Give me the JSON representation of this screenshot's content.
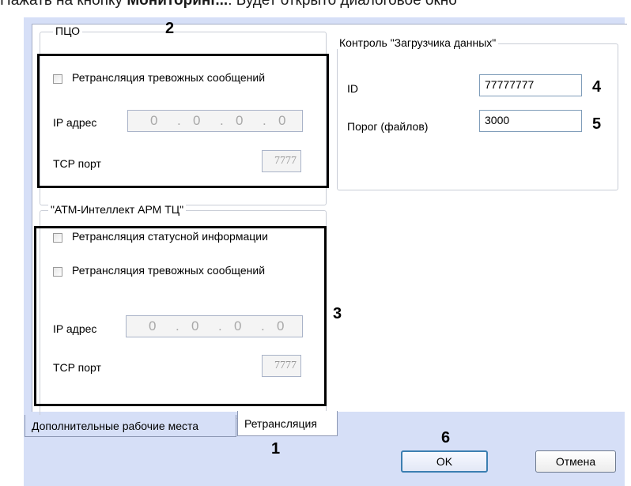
{
  "caption": {
    "prefix": "Нажать на кнопку ",
    "bold": "Мониторинг...",
    "suffix": ". Будет открыто диалоговое окно"
  },
  "pco": {
    "legend": "ПЦО",
    "relay_alarm_label": "Ретрансляция тревожных сообщений",
    "ip_label": "IP адрес",
    "ip_octets": [
      "0",
      "0",
      "0",
      "0"
    ],
    "tcp_label": "TCP порт",
    "tcp_port": "7777"
  },
  "atm": {
    "legend": "\"АТМ-Интеллект АРМ ТЦ\"",
    "relay_status_label": "Ретрансляция статусной информации",
    "relay_alarm_label": "Ретрансляция тревожных сообщений",
    "ip_label": "IP адрес",
    "ip_octets": [
      "0",
      "0",
      "0",
      "0"
    ],
    "tcp_label": "TCP порт",
    "tcp_port": "7777"
  },
  "loader": {
    "legend": "Контроль \"Загрузчика данных\"",
    "id_label": "ID",
    "id_value": "77777777",
    "threshold_label": "Порог (файлов)",
    "threshold_value": "3000"
  },
  "tabs": [
    "Дополнительные рабочие места",
    "Ретрансляция"
  ],
  "buttons": {
    "ok": "OK",
    "cancel": "Отмена"
  },
  "markers": [
    "1",
    "2",
    "3",
    "4",
    "5",
    "6"
  ]
}
